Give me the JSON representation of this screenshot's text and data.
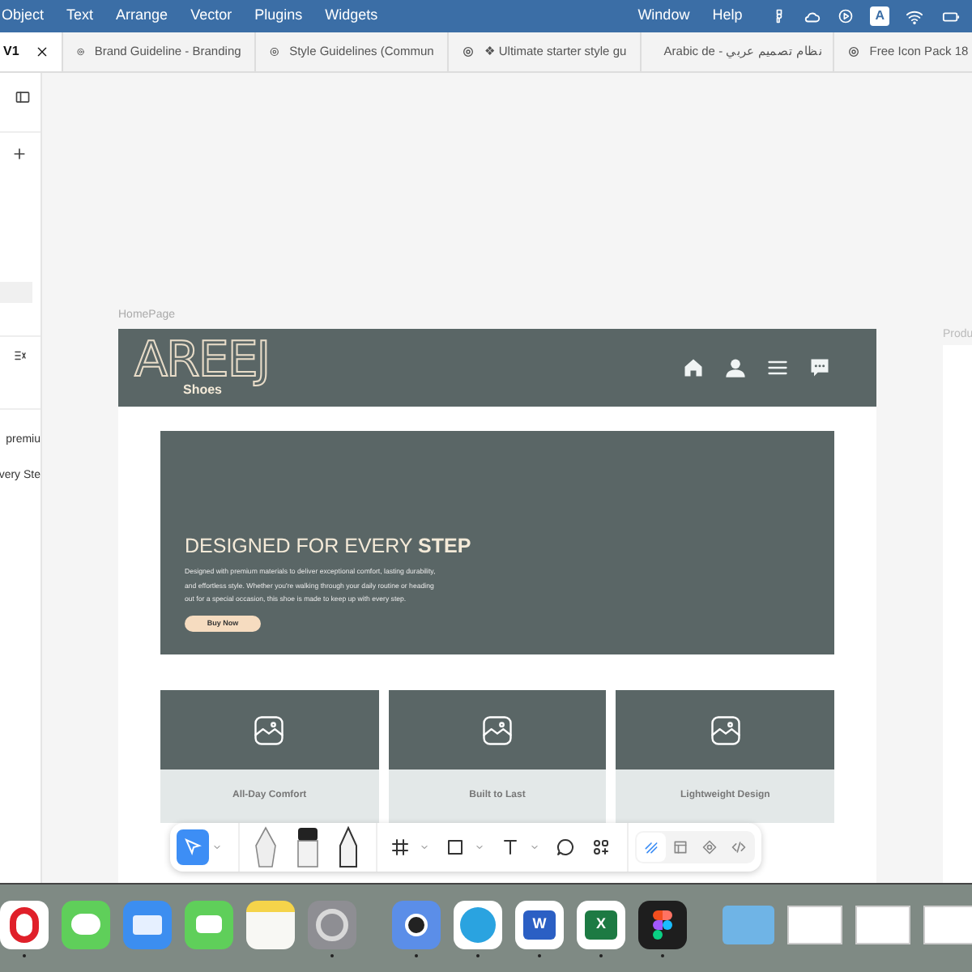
{
  "menu_bar": {
    "items": [
      "Object",
      "Text",
      "Arrange",
      "Vector",
      "Plugins",
      "Widgets"
    ],
    "right_items": [
      "Window",
      "Help"
    ],
    "status_badge": "A"
  },
  "tabs": [
    {
      "label": "V1",
      "selected": true
    },
    {
      "label": "Brand Guideline - Branding",
      "selected": false
    },
    {
      "label": "Style Guidelines (Commun",
      "selected": false
    },
    {
      "label": "❖ Ultimate starter style gu",
      "selected": false
    },
    {
      "label": "نظام تصميم عربي - Arabic de",
      "selected": false
    },
    {
      "label": "Free Icon Pack 18",
      "selected": false
    }
  ],
  "left_panel": {
    "layers": [
      "premiu",
      "very Ste"
    ]
  },
  "canvas": {
    "frame_label": "HomePage",
    "second_frame_label": "Produ",
    "site": {
      "logo": {
        "title": "AREEJ",
        "subtitle": "Shoes"
      },
      "hero": {
        "headline": "DESIGNED FOR EVERY **STEP**",
        "body": "Designed with premium materials to deliver exceptional comfort, lasting durability, and effortless style. Whether you're walking through your daily routine or heading out for a special occasion, this shoe is made to keep up with every step.",
        "button": "Buy Now"
      },
      "cards": [
        {
          "title": "All-Day Comfort"
        },
        {
          "title": "Built to Last"
        },
        {
          "title": "Lightweight Design"
        }
      ]
    }
  },
  "toolbar": {
    "tools": [
      {
        "kind": "move",
        "selected": true
      },
      {
        "kind": "pen",
        "selected": false
      },
      {
        "kind": "brush",
        "selected": false
      },
      {
        "kind": "pencil",
        "selected": false
      },
      {
        "kind": "frame",
        "selected": false
      },
      {
        "kind": "shape",
        "selected": false
      },
      {
        "kind": "text",
        "selected": false
      },
      {
        "kind": "comment",
        "selected": false
      },
      {
        "kind": "actions",
        "selected": false
      }
    ],
    "modes": [
      {
        "kind": "draw",
        "selected": true
      },
      {
        "kind": "layout",
        "selected": false
      },
      {
        "kind": "prototype",
        "selected": false
      },
      {
        "kind": "code",
        "selected": false
      }
    ]
  },
  "dock": {
    "apps": [
      {
        "kind": "opera",
        "running": true
      },
      {
        "kind": "messages",
        "running": false
      },
      {
        "kind": "mail",
        "running": false
      },
      {
        "kind": "facetime",
        "running": false
      },
      {
        "kind": "notes",
        "running": false
      },
      {
        "kind": "settings",
        "running": true
      },
      {
        "kind": "divider"
      },
      {
        "kind": "preview",
        "running": true
      },
      {
        "kind": "telegram",
        "running": true
      },
      {
        "kind": "word",
        "letter": "W",
        "running": true
      },
      {
        "kind": "excel",
        "letter": "X",
        "running": true
      },
      {
        "kind": "figma",
        "running": true
      },
      {
        "kind": "divider"
      },
      {
        "kind": "folder"
      },
      {
        "kind": "thumbnail"
      },
      {
        "kind": "thumbnail"
      },
      {
        "kind": "thumbnail"
      }
    ]
  }
}
